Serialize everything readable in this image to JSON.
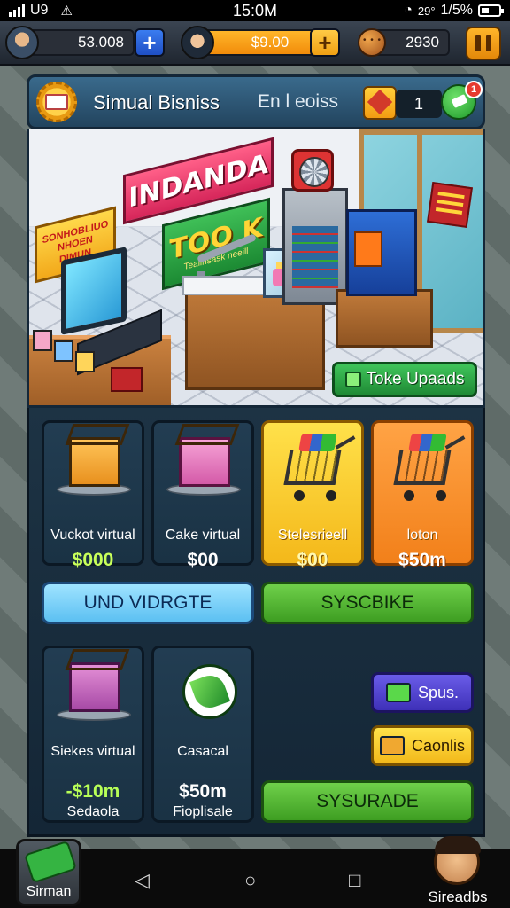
{
  "status_bar": {
    "left_text": "U9",
    "time": "15:0M",
    "right_text": "29°",
    "battery": "1/5%"
  },
  "resources": {
    "cash": "53.008",
    "gold": "$9.00",
    "cookies": "2930"
  },
  "header": {
    "title": "Simual Bisniss",
    "subtitle": "En l eoiss",
    "count": "1",
    "notification_badge": "1"
  },
  "store": {
    "sign_red": "INDANDA",
    "sign_green_big": "TOO K",
    "sign_green_small": "Tealinsask neeill",
    "sign_yellow": "SONHOBLIUO NHOEN DIMUN",
    "action_button": "Toke Upaads"
  },
  "shop": {
    "cards": [
      {
        "name": "Vuckot virtual",
        "price": "$000",
        "icon": "box-icon"
      },
      {
        "name": "Cake virtual",
        "price": "$00",
        "icon": "cake-box-icon"
      },
      {
        "name": "Stelesrieell",
        "price": "$00",
        "icon": "cart-icon"
      },
      {
        "name": "loton",
        "price": "$50m",
        "icon": "cart-icon"
      }
    ],
    "button_left": "UND VIDRGTE",
    "button_right": "SYSCBIKE",
    "cards2": [
      {
        "name": "Siekes virtual",
        "price": "-$10m",
        "sub": "Sedaola",
        "icon": "gift-box-icon"
      },
      {
        "name": "Casacal",
        "price": "$50m",
        "sub": "Fioplisale",
        "icon": "leaf-icon"
      }
    ],
    "spus_button": "Spus.",
    "caonlis_button": "Caonlis",
    "sysurade_button": "SYSURADE"
  },
  "nav": {
    "left_label": "Sirman",
    "right_label": "Sireadbs"
  },
  "colors": {
    "accent_green": "#3e9e22",
    "accent_blue": "#5cc0f2",
    "accent_yellow": "#f4b81a",
    "accent_orange": "#f2801a",
    "panel": "#1d3344"
  }
}
